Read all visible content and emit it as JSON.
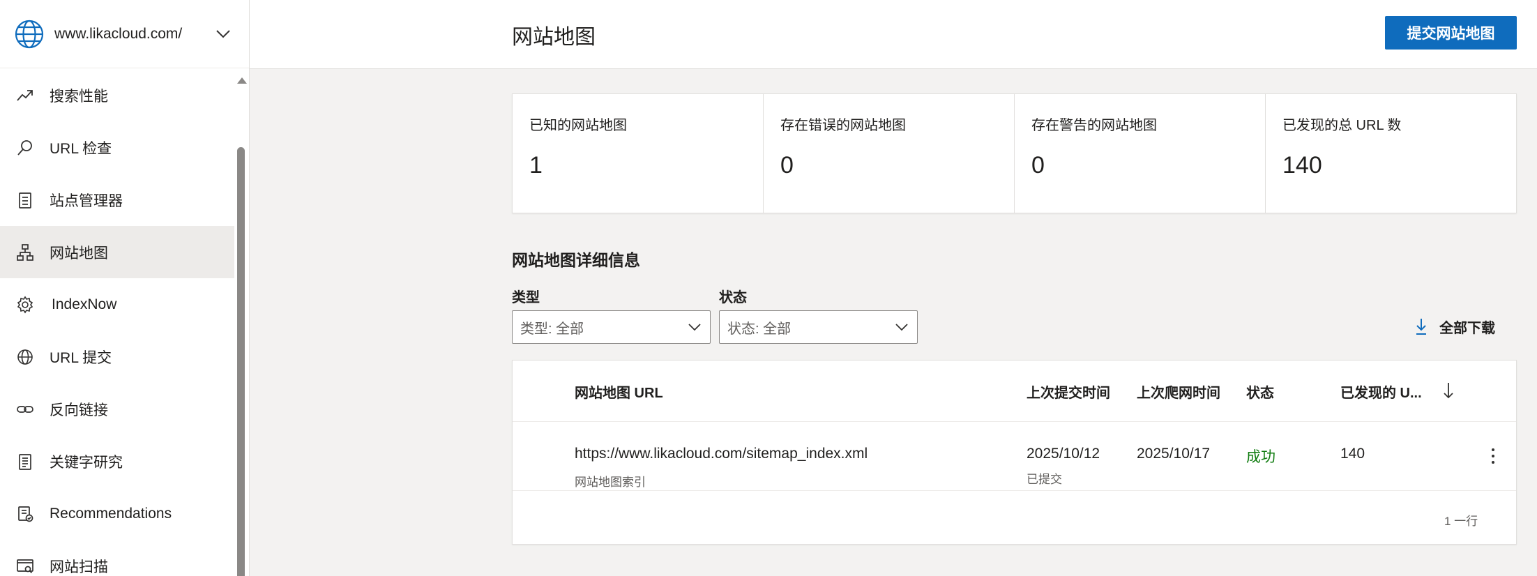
{
  "sidebar": {
    "site_url": "www.likacloud.com/",
    "items": [
      {
        "label": "搜索性能",
        "icon": "trend-up-icon",
        "active": false
      },
      {
        "label": "URL 检查",
        "icon": "search-icon",
        "active": false
      },
      {
        "label": "站点管理器",
        "icon": "clipboard-list-icon",
        "active": false
      },
      {
        "label": "网站地图",
        "icon": "sitemap-icon",
        "active": true
      },
      {
        "label": "IndexNow",
        "icon": "gear-icon",
        "active": false
      },
      {
        "label": "URL 提交",
        "icon": "globe-icon",
        "active": false
      },
      {
        "label": "反向链接",
        "icon": "link-icon",
        "active": false
      },
      {
        "label": "关键字研究",
        "icon": "document-list-icon",
        "active": false
      },
      {
        "label": "Recommendations",
        "icon": "document-check-icon",
        "active": false
      },
      {
        "label": "网站扫描",
        "icon": "window-scan-icon",
        "active": false
      }
    ]
  },
  "header": {
    "title": "网站地图",
    "submit_label": "提交网站地图"
  },
  "stats": [
    {
      "label": "已知的网站地图",
      "value": "1"
    },
    {
      "label": "存在错误的网站地图",
      "value": "0"
    },
    {
      "label": "存在警告的网站地图",
      "value": "0"
    },
    {
      "label": "已发现的总 URL 数",
      "value": "140"
    }
  ],
  "details": {
    "title": "网站地图详细信息",
    "filters": {
      "type_label": "类型",
      "type_value": "类型: 全部",
      "status_label": "状态",
      "status_value": "状态: 全部"
    },
    "download_label": "全部下载"
  },
  "table": {
    "columns": {
      "url": "网站地图 URL",
      "last_submitted": "上次提交时间",
      "last_crawled": "上次爬网时间",
      "status": "状态",
      "discovered": "已发现的 U..."
    },
    "rows": [
      {
        "url": "https://www.likacloud.com/sitemap_index.xml",
        "type": "网站地图索引",
        "last_submitted": "2025/10/12",
        "submitted_note": "已提交",
        "last_crawled": "2025/10/17",
        "status": "成功",
        "discovered": "140"
      }
    ],
    "row_count": "1 一行"
  },
  "colors": {
    "accent": "#0f6cbd",
    "success": "#107c10",
    "active_bg": "#edebe9"
  }
}
